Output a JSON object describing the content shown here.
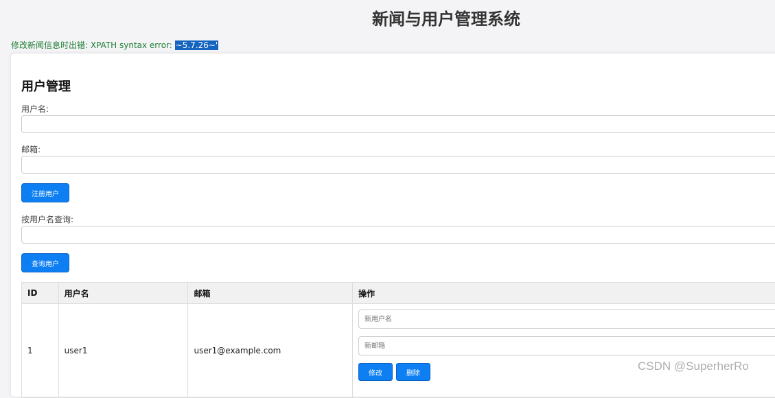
{
  "header": {
    "title": "新闻与用户管理系统"
  },
  "error": {
    "prefix": "修改新闻信息时出错: XPATH syntax error: ",
    "selected": "~5.7.26~'"
  },
  "user_mgmt": {
    "heading": "用户管理",
    "username_label": "用户名:",
    "username_value": "",
    "email_label": "邮箱:",
    "email_value": "",
    "register_button": "注册用户",
    "query_label": "按用户名查询:",
    "query_value": "",
    "query_button": "查询用户"
  },
  "table": {
    "headers": [
      "ID",
      "用户名",
      "邮箱",
      "操作"
    ],
    "rows": [
      {
        "id": "1",
        "username": "user1",
        "email": "user1@example.com",
        "new_username_placeholder": "新用户名",
        "new_email_placeholder": "新邮箱",
        "edit_label": "修改",
        "delete_label": "删除"
      }
    ]
  },
  "watermark": "CSDN @SuperherRo"
}
